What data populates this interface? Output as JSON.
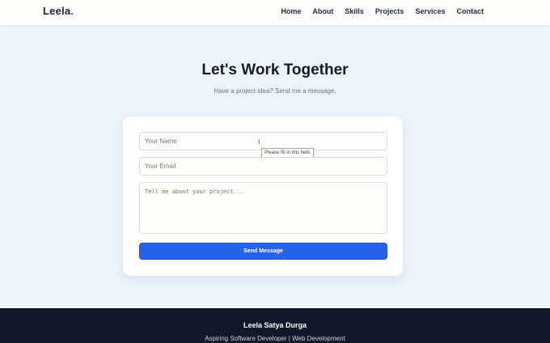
{
  "header": {
    "logo_text": "Leela",
    "logo_dot": ".",
    "nav": [
      "Home",
      "About",
      "Skills",
      "Projects",
      "Services",
      "Contact"
    ]
  },
  "contact": {
    "title": "Let's Work Together",
    "subtitle": "Have a project idea? Send me a message.",
    "name_placeholder": "Your Name",
    "email_placeholder": "Your Email",
    "message_placeholder": "Tell me about your project...",
    "validation_tooltip": "Please fill in this field.",
    "submit_label": "Send Message"
  },
  "footer": {
    "name": "Leela Satya Durga",
    "tagline": "Aspiring Software Developer | Web Development"
  },
  "colors": {
    "accent": "#2563eb",
    "page_background": "#edf4fe",
    "footer_background": "#111827"
  },
  "icons": {
    "cursor": "text-cursor-icon"
  }
}
